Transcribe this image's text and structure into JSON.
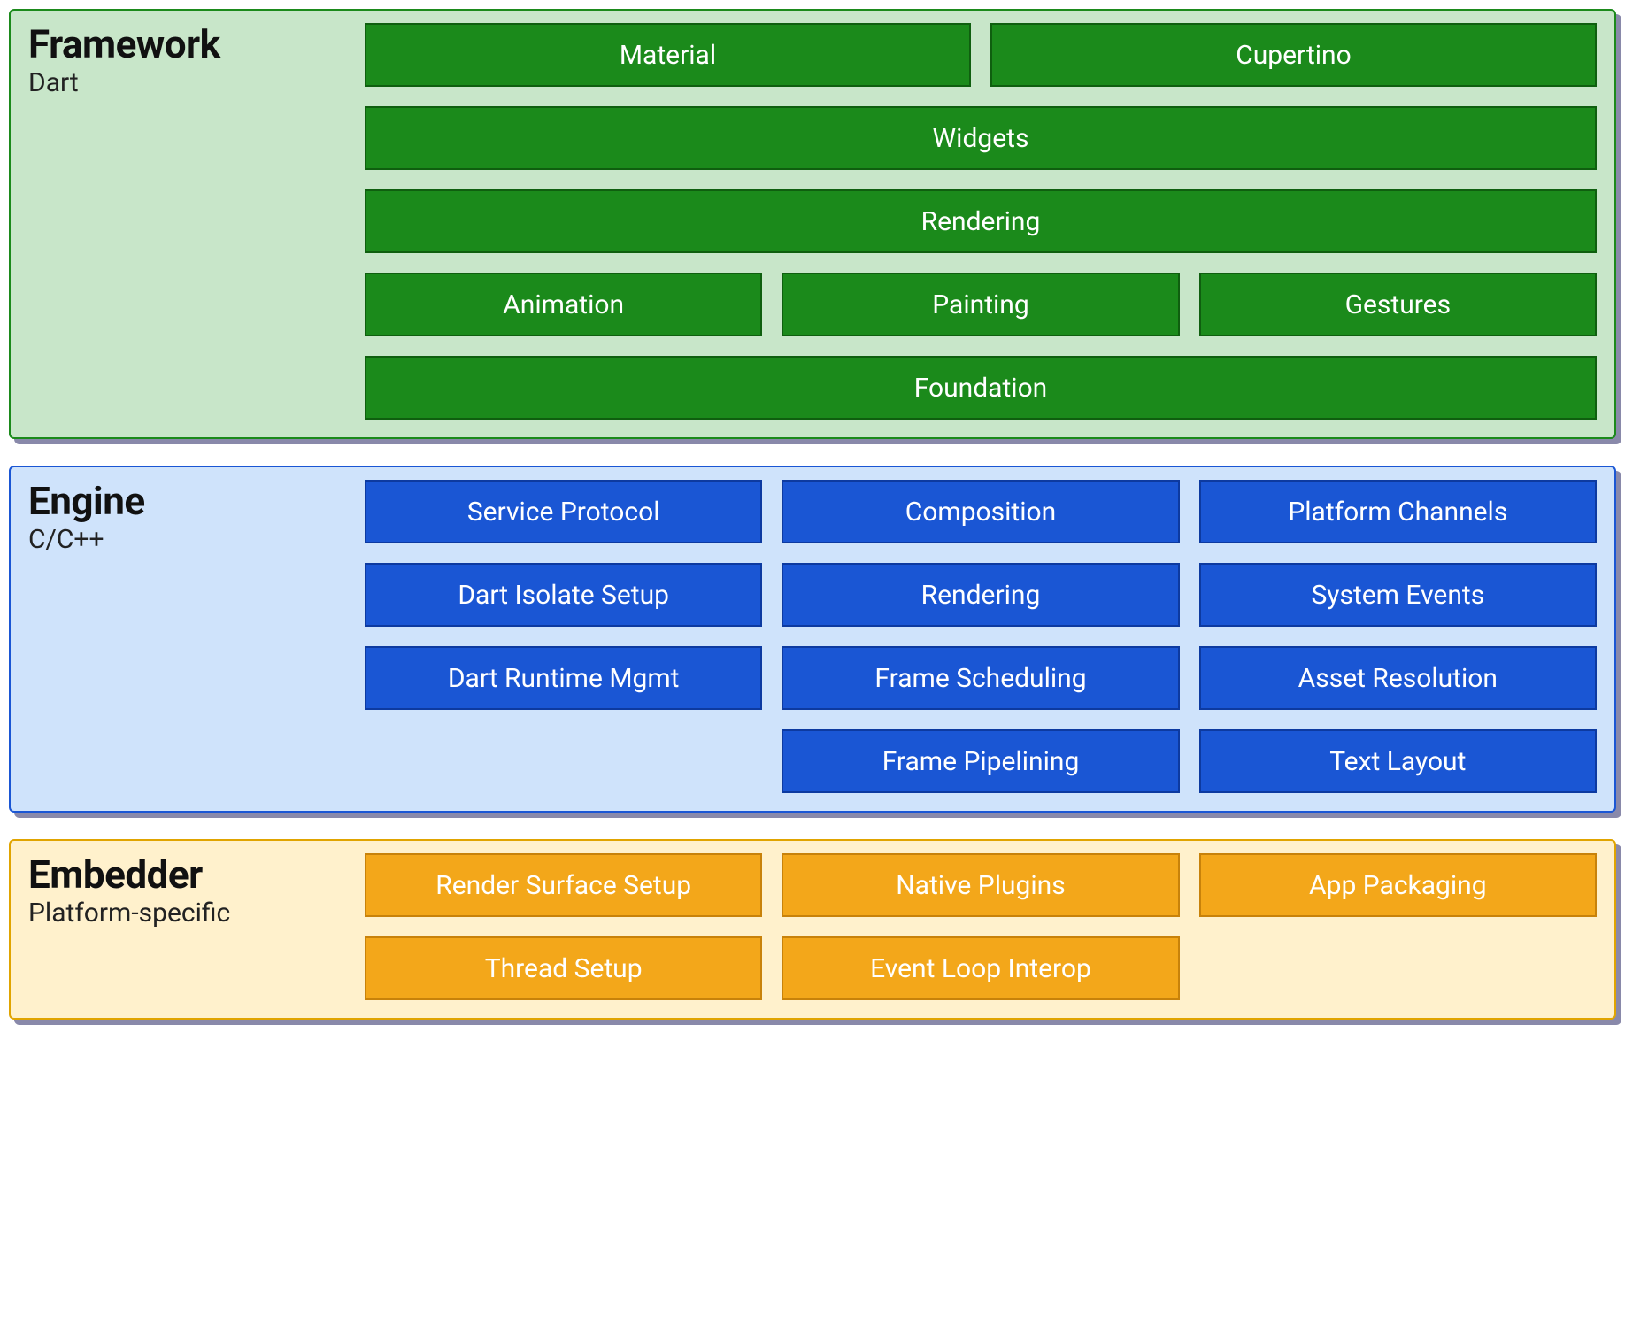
{
  "framework": {
    "title": "Framework",
    "subtitle": "Dart",
    "row1": {
      "material": "Material",
      "cupertino": "Cupertino"
    },
    "row2": {
      "widgets": "Widgets"
    },
    "row3": {
      "rendering": "Rendering"
    },
    "row4": {
      "animation": "Animation",
      "painting": "Painting",
      "gestures": "Gestures"
    },
    "row5": {
      "foundation": "Foundation"
    }
  },
  "engine": {
    "title": "Engine",
    "subtitle": "C/C++",
    "row1": {
      "service_protocol": "Service Protocol",
      "composition": "Composition",
      "platform_channels": "Platform Channels"
    },
    "row2": {
      "dart_isolate_setup": "Dart Isolate Setup",
      "rendering": "Rendering",
      "system_events": "System Events"
    },
    "row3": {
      "dart_runtime_mgmt": "Dart Runtime Mgmt",
      "frame_scheduling": "Frame Scheduling",
      "asset_resolution": "Asset Resolution"
    },
    "row4": {
      "frame_pipelining": "Frame Pipelining",
      "text_layout": "Text Layout"
    }
  },
  "embedder": {
    "title": "Embedder",
    "subtitle": "Platform-specific",
    "row1": {
      "render_surface_setup": "Render Surface Setup",
      "native_plugins": "Native Plugins",
      "app_packaging": "App Packaging"
    },
    "row2": {
      "thread_setup": "Thread Setup",
      "event_loop_interop": "Event Loop Interop"
    }
  }
}
